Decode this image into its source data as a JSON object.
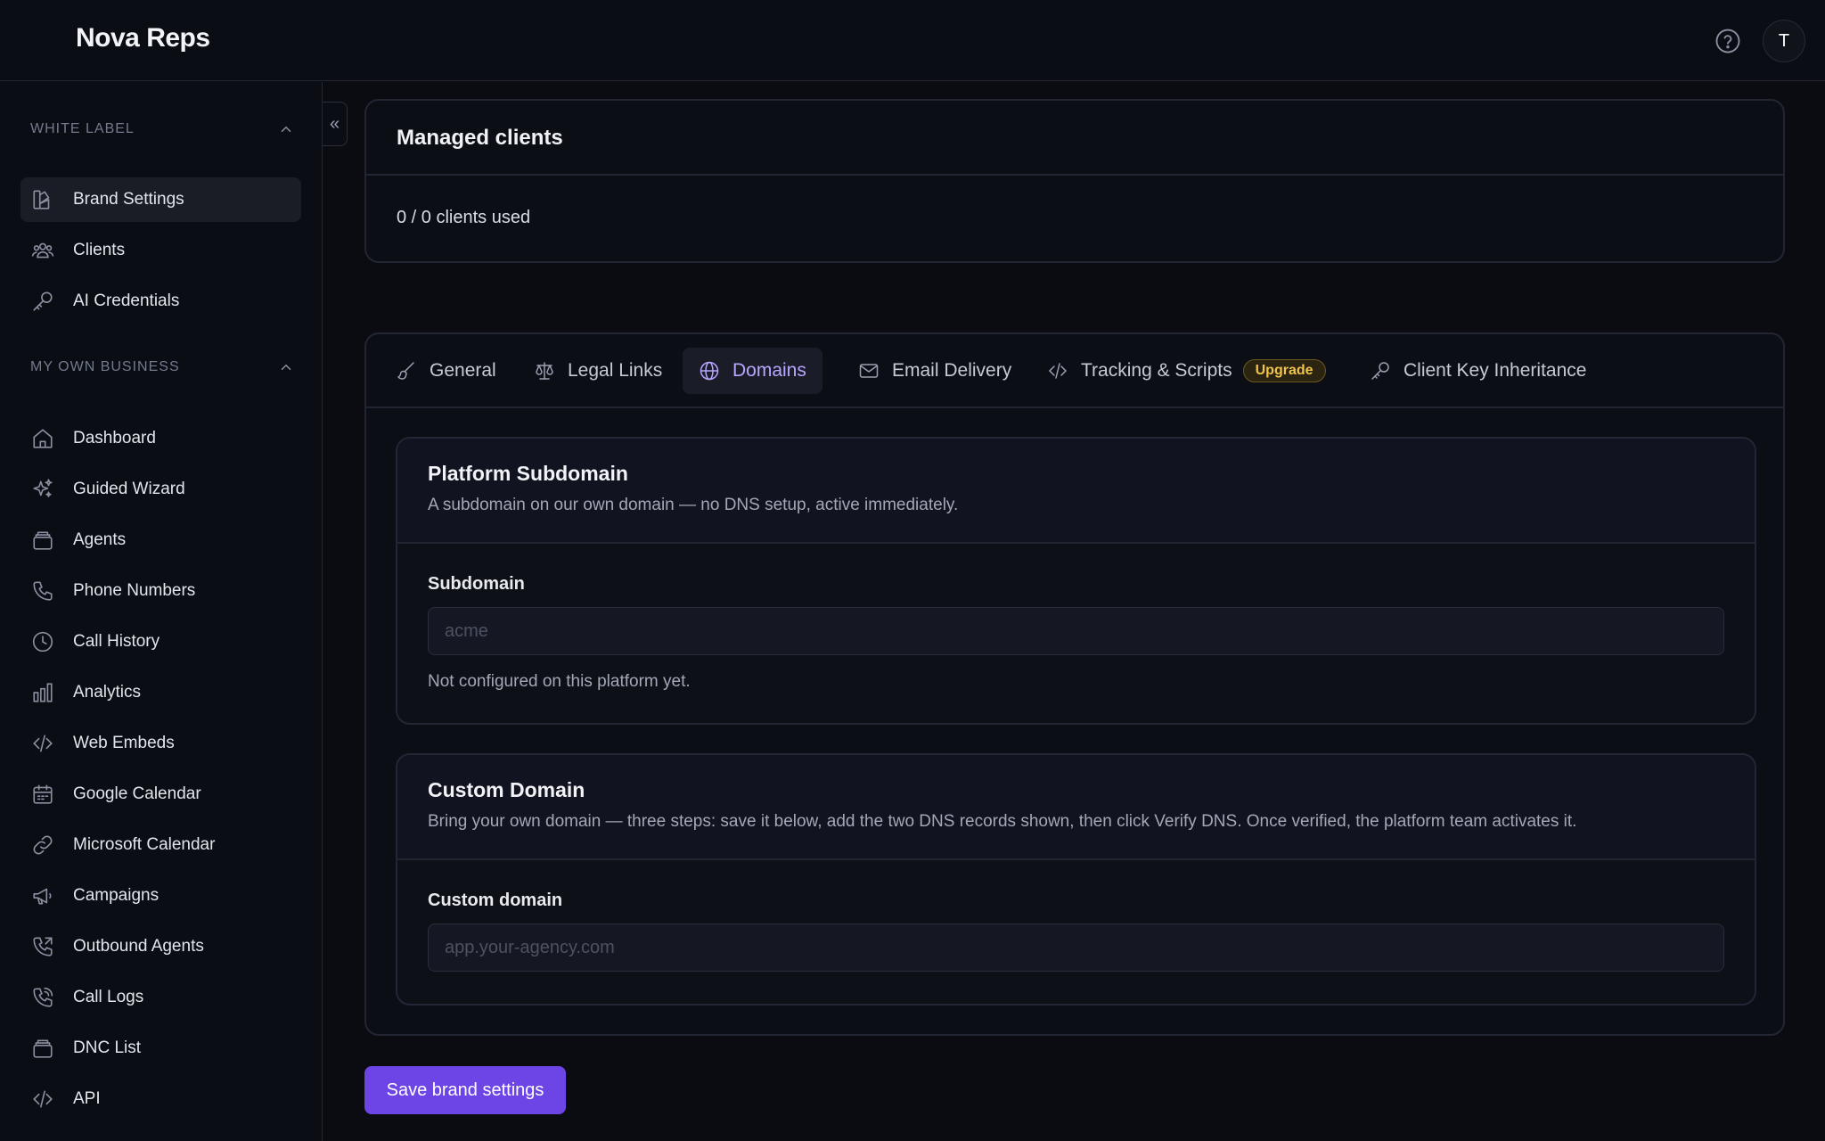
{
  "app": {
    "title": "Nova Reps"
  },
  "header": {
    "avatar_initial": "T"
  },
  "sidebar": {
    "sections": [
      {
        "title": "WHITE LABEL",
        "items": [
          {
            "label": "Brand Settings",
            "icon": "palette-icon",
            "active": true
          },
          {
            "label": "Clients",
            "icon": "users-icon"
          },
          {
            "label": "AI Credentials",
            "icon": "key-icon"
          }
        ]
      },
      {
        "title": "MY OWN BUSINESS",
        "items": [
          {
            "label": "Dashboard",
            "icon": "home-icon"
          },
          {
            "label": "Guided Wizard",
            "icon": "sparkles-icon"
          },
          {
            "label": "Agents",
            "icon": "layers-icon"
          },
          {
            "label": "Phone Numbers",
            "icon": "phone-icon"
          },
          {
            "label": "Call History",
            "icon": "clock-icon"
          },
          {
            "label": "Analytics",
            "icon": "bar-chart-icon"
          },
          {
            "label": "Web Embeds",
            "icon": "code-icon"
          },
          {
            "label": "Google Calendar",
            "icon": "calendar-icon"
          },
          {
            "label": "Microsoft Calendar",
            "icon": "link-icon"
          },
          {
            "label": "Campaigns",
            "icon": "megaphone-icon"
          },
          {
            "label": "Outbound Agents",
            "icon": "phone-outgoing-icon"
          },
          {
            "label": "Call Logs",
            "icon": "phone-log-icon"
          },
          {
            "label": "DNC List",
            "icon": "layers-icon"
          },
          {
            "label": "API",
            "icon": "code-icon"
          }
        ]
      }
    ]
  },
  "managed_clients": {
    "title": "Managed clients",
    "usage": "0 / 0 clients used"
  },
  "tabs": [
    {
      "label": "General",
      "icon": "brush-icon"
    },
    {
      "label": "Legal Links",
      "icon": "scale-icon"
    },
    {
      "label": "Domains",
      "icon": "globe-icon",
      "active": true
    },
    {
      "label": "Email Delivery",
      "icon": "mail-icon"
    },
    {
      "label": "Tracking & Scripts",
      "icon": "code-icon",
      "badge": "Upgrade"
    },
    {
      "label": "Client Key Inheritance",
      "icon": "key-icon"
    }
  ],
  "platform_subdomain": {
    "title": "Platform Subdomain",
    "description": "A subdomain on our own domain — no DNS setup, active immediately.",
    "field_label": "Subdomain",
    "placeholder": "acme",
    "helper": "Not configured on this platform yet."
  },
  "custom_domain": {
    "title": "Custom Domain",
    "description": "Bring your own domain — three steps: save it below, add the two DNS records shown, then click Verify DNS. Once verified, the platform team activates it.",
    "field_label": "Custom domain",
    "placeholder": "app.your-agency.com"
  },
  "actions": {
    "save_label": "Save brand settings"
  },
  "colors": {
    "accent": "#6d45e6",
    "active_tab_text": "#b9a6ff",
    "badge": "#f0c34a"
  }
}
